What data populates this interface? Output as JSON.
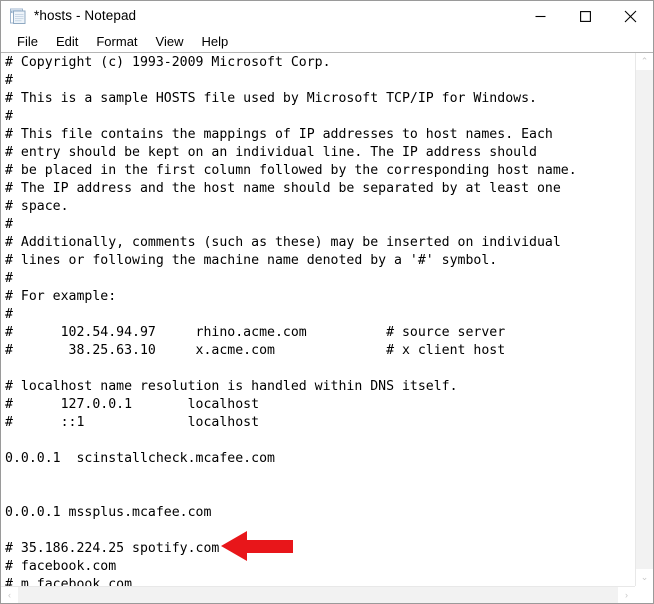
{
  "window": {
    "title": "*hosts - Notepad",
    "icon": "notepad-icon",
    "controls": {
      "minimize": "—",
      "maximize": "☐",
      "close": "✕"
    }
  },
  "menubar": {
    "items": [
      {
        "label": "File"
      },
      {
        "label": "Edit"
      },
      {
        "label": "Format"
      },
      {
        "label": "View"
      },
      {
        "label": "Help"
      }
    ]
  },
  "editor": {
    "lines": [
      "# Copyright (c) 1993-2009 Microsoft Corp.",
      "#",
      "# This is a sample HOSTS file used by Microsoft TCP/IP for Windows.",
      "#",
      "# This file contains the mappings of IP addresses to host names. Each",
      "# entry should be kept on an individual line. The IP address should",
      "# be placed in the first column followed by the corresponding host name.",
      "# The IP address and the host name should be separated by at least one",
      "# space.",
      "#",
      "# Additionally, comments (such as these) may be inserted on individual",
      "# lines or following the machine name denoted by a '#' symbol.",
      "#",
      "# For example:",
      "#",
      "#      102.54.94.97     rhino.acme.com          # source server",
      "#       38.25.63.10     x.acme.com              # x client host",
      "",
      "# localhost name resolution is handled within DNS itself.",
      "#      127.0.0.1       localhost",
      "#      ::1             localhost",
      "",
      "0.0.0.1  scinstallcheck.mcafee.com",
      "",
      "",
      "0.0.0.1 mssplus.mcafee.com",
      "",
      "# 35.186.224.25 spotify.com",
      "# facebook.com",
      "# m.facebook.com"
    ]
  },
  "scrollbars": {
    "vertical": {
      "up_arrow": "⌃",
      "down_arrow": "⌄"
    },
    "horizontal": {
      "left_arrow": "‹",
      "right_arrow": "›"
    }
  },
  "annotation": {
    "arrow": {
      "name": "red-left-arrow",
      "color": "#e8161a",
      "direction": "left",
      "points_at": "# 35.186.224.25 spotify.com"
    }
  }
}
